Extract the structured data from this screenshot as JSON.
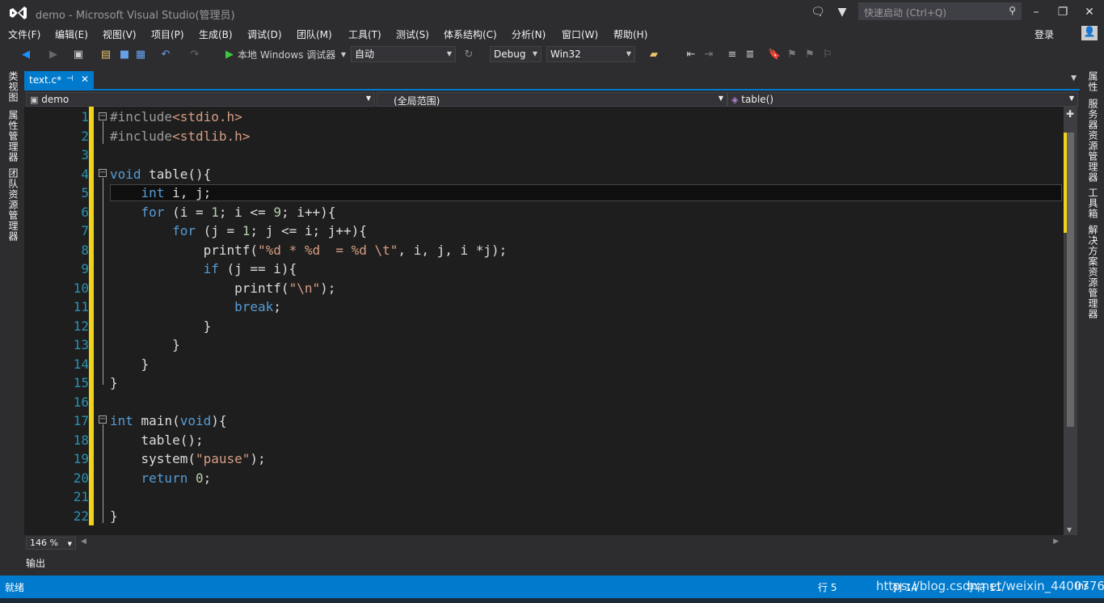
{
  "window": {
    "title": "demo - Microsoft Visual Studio(管理员)",
    "quick_launch_placeholder": "快速启动 (Ctrl+Q)",
    "sign_in": "登录"
  },
  "menu": [
    "文件(F)",
    "编辑(E)",
    "视图(V)",
    "项目(P)",
    "生成(B)",
    "调试(D)",
    "团队(M)",
    "工具(T)",
    "测试(S)",
    "体系结构(C)",
    "分析(N)",
    "窗口(W)",
    "帮助(H)"
  ],
  "toolbar": {
    "run_label": "本地 Windows 调试器",
    "auto_combo": "自动",
    "config_combo": "Debug",
    "platform_combo": "Win32"
  },
  "left_tabs": [
    "类视图",
    "属性管理器",
    "团队资源管理器"
  ],
  "right_tabs": [
    "属性",
    "服务器资源管理器",
    "工具箱",
    "解决方案资源管理器"
  ],
  "doc_tab": {
    "label": "text.c*",
    "pin": "⊣",
    "close": "✕"
  },
  "nav": {
    "project": "demo",
    "scope": "(全局范围)",
    "member": "table()"
  },
  "editor": {
    "line_numbers": [
      "1",
      "2",
      "3",
      "4",
      "5",
      "6",
      "7",
      "8",
      "9",
      "10",
      "11",
      "12",
      "13",
      "14",
      "15",
      "16",
      "17",
      "18",
      "19",
      "20",
      "21",
      "22"
    ],
    "lines": [
      [
        [
          "pp",
          "#include"
        ],
        [
          "str",
          "<stdio.h>"
        ]
      ],
      [
        [
          "pp",
          "#include"
        ],
        [
          "str",
          "<stdlib.h>"
        ]
      ],
      [],
      [
        [
          "kw",
          "void"
        ],
        [
          "t",
          " table(){"
        ]
      ],
      [
        [
          "t",
          "    "
        ],
        [
          "kw",
          "int"
        ],
        [
          "t",
          " i, j;"
        ]
      ],
      [
        [
          "t",
          "    "
        ],
        [
          "kw",
          "for"
        ],
        [
          "t",
          " (i = "
        ],
        [
          "num",
          "1"
        ],
        [
          "t",
          "; i <= "
        ],
        [
          "num",
          "9"
        ],
        [
          "t",
          "; i++){"
        ]
      ],
      [
        [
          "t",
          "        "
        ],
        [
          "kw",
          "for"
        ],
        [
          "t",
          " (j = "
        ],
        [
          "num",
          "1"
        ],
        [
          "t",
          "; j <= i; j++){"
        ]
      ],
      [
        [
          "t",
          "            printf("
        ],
        [
          "str",
          "\"%d * %d  = %d \\t\""
        ],
        [
          "t",
          ", i, j, i *j);"
        ]
      ],
      [
        [
          "t",
          "            "
        ],
        [
          "kw",
          "if"
        ],
        [
          "t",
          " (j == i){"
        ]
      ],
      [
        [
          "t",
          "                printf("
        ],
        [
          "str",
          "\"\\n\""
        ],
        [
          "t",
          ");"
        ]
      ],
      [
        [
          "t",
          "                "
        ],
        [
          "kw",
          "break"
        ],
        [
          "t",
          ";"
        ]
      ],
      [
        [
          "t",
          "            }"
        ]
      ],
      [
        [
          "t",
          "        }"
        ]
      ],
      [
        [
          "t",
          "    }"
        ]
      ],
      [
        [
          "t",
          "}"
        ]
      ],
      [],
      [
        [
          "kw",
          "int"
        ],
        [
          "t",
          " main("
        ],
        [
          "kw",
          "void"
        ],
        [
          "t",
          "){"
        ]
      ],
      [
        [
          "t",
          "    table();"
        ]
      ],
      [
        [
          "t",
          "    system("
        ],
        [
          "str",
          "\"pause\""
        ],
        [
          "t",
          ");"
        ]
      ],
      [
        [
          "t",
          "    "
        ],
        [
          "kw",
          "return"
        ],
        [
          "t",
          " "
        ],
        [
          "num",
          "0"
        ],
        [
          "t",
          ";"
        ]
      ],
      [],
      [
        [
          "t",
          "}"
        ]
      ]
    ]
  },
  "zoom": "146 %",
  "output_label": "输出",
  "status": {
    "left": "就绪",
    "line": "行 5",
    "col": "列 14",
    "char": "字符 11",
    "mode": "Ins",
    "watermark": "https://blog.csdn.net/weixin_44007763"
  },
  "colors": {
    "accent": "#007acc",
    "keyword": "#569cd6",
    "string": "#d69d85",
    "preprocessor": "#9b9b9b",
    "line_number": "#2b91af",
    "change_bar": "#efd219"
  }
}
